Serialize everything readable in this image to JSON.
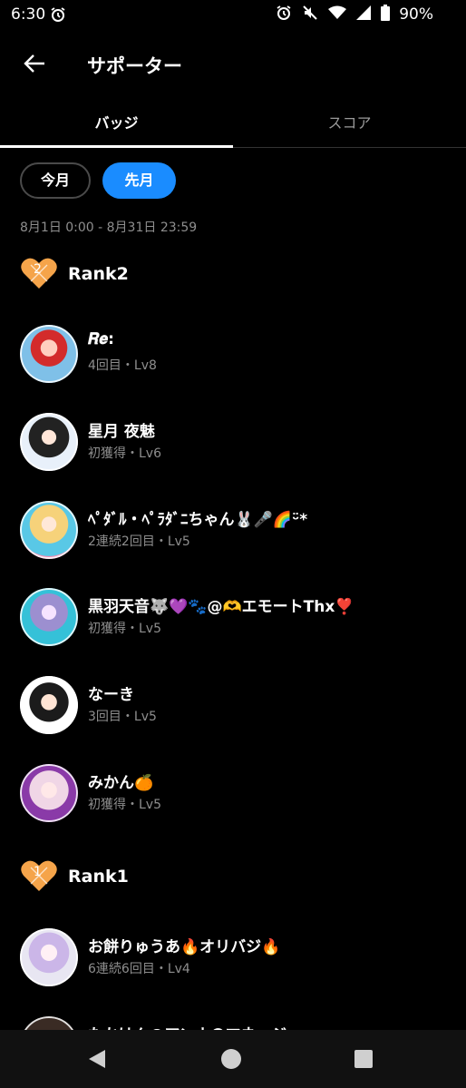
{
  "status_bar": {
    "time": "6:30",
    "battery": "90%"
  },
  "header": {
    "title": "サポーター"
  },
  "tabs": [
    {
      "label": "バッジ"
    },
    {
      "label": "スコア"
    }
  ],
  "filters": {
    "this_month": "今月",
    "last_month": "先月"
  },
  "date_range": "8月1日 0:00 - 8月31日 23:59",
  "ranks": [
    {
      "label": "Rank2",
      "heart_number": "2",
      "items": [
        {
          "name": "𝑹𝒆:",
          "sub": "4回目・Lv8"
        },
        {
          "name": "星月 夜魅",
          "sub": "初獲得・Lv6"
        },
        {
          "name": "ﾍﾟﾀﾞﾙ・ﾍﾟﾗﾀﾞﾆちゃん🐰🎤🌈ᵕ̈*",
          "sub": "2連続2回目・Lv5"
        },
        {
          "name": "黒羽天音🐺💜🐾@🫶エモートThx❣️",
          "sub": "初獲得・Lv5"
        },
        {
          "name": "なーき",
          "sub": "3回目・Lv5"
        },
        {
          "name": "みかん🍊",
          "sub": "初獲得・Lv5"
        }
      ]
    },
    {
      "label": "Rank1",
      "heart_number": "1",
      "items": [
        {
          "name": "お餅りゅうあ🔥オリバジ🔥",
          "sub": "6連続6回目・Lv4"
        },
        {
          "name": "たかはん@アンナのマネージャー",
          "sub": ""
        }
      ]
    }
  ],
  "colors": {
    "accent": "#1a8cff",
    "heart": "#f5a44a"
  }
}
